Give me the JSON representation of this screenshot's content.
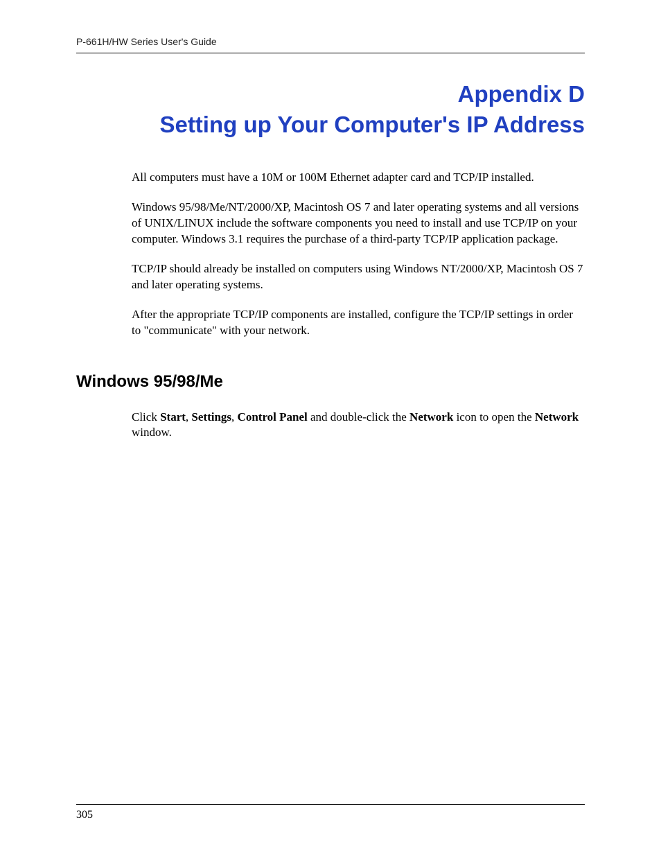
{
  "header": {
    "guide_title": "P-661H/HW Series User's Guide"
  },
  "title": {
    "appendix_label": "Appendix D",
    "appendix_title": "Setting up Your Computer's IP Address"
  },
  "body": {
    "p1": "All computers must have a 10M or 100M Ethernet adapter card and TCP/IP installed.",
    "p2": "Windows 95/98/Me/NT/2000/XP, Macintosh OS 7 and later operating systems and all versions of UNIX/LINUX include the software components you need to install and use TCP/IP on your computer. Windows 3.1 requires the purchase of a third-party TCP/IP application package.",
    "p3": "TCP/IP should already be installed on computers using Windows NT/2000/XP, Macintosh OS 7 and later operating systems.",
    "p4": "After the appropriate TCP/IP components are installed, configure the TCP/IP settings in order to \"communicate\" with your network."
  },
  "section": {
    "heading": "Windows 95/98/Me",
    "instruction": {
      "t1": "Click ",
      "b1": "Start",
      "t2": ", ",
      "b2": "Settings",
      "t3": ", ",
      "b3": "Control Panel",
      "t4": " and double-click the ",
      "b4": "Network",
      "t5": " icon to open the ",
      "b5": "Network",
      "t6": " window."
    }
  },
  "footer": {
    "page_number": "305"
  }
}
